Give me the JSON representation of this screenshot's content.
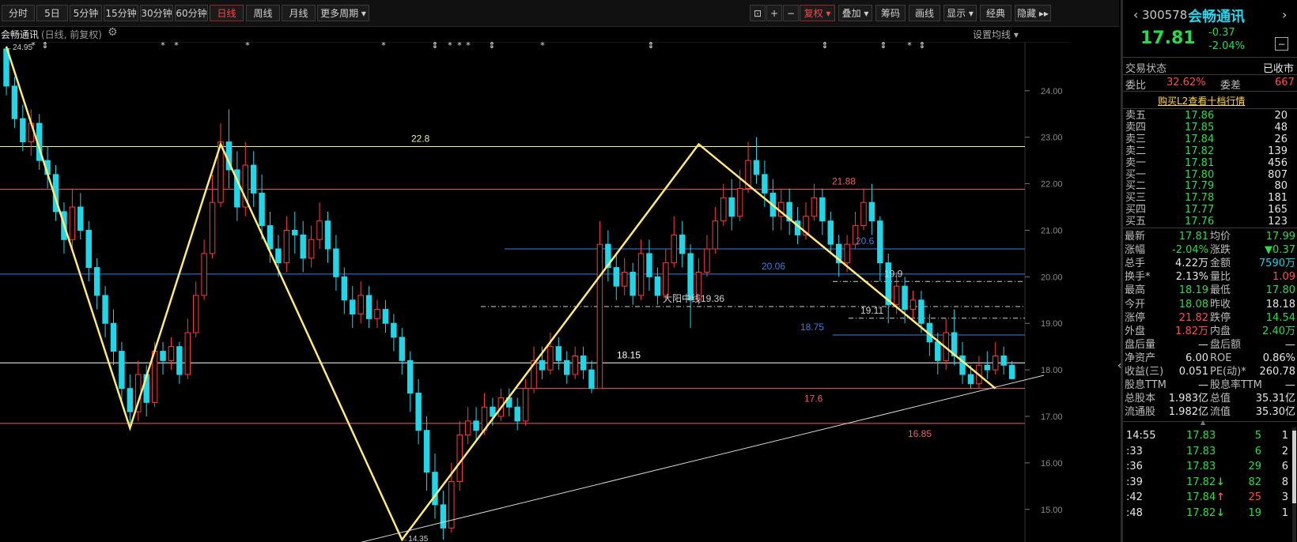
{
  "toolbar": {
    "periods": [
      "分时",
      "5日",
      "5分钟",
      "15分钟",
      "30分钟",
      "60分钟",
      "日线",
      "周线",
      "月线",
      "更多周期"
    ],
    "active_period": "日线",
    "zoom_in": "+",
    "zoom_out": "−",
    "right_buttons": [
      "复权",
      "叠加",
      "筹码",
      "画线",
      "显示",
      "经典",
      "隐藏"
    ],
    "active_right": "复权"
  },
  "chart_header": {
    "stock_name": "会畅通讯",
    "mode": "(日线, 前复权)",
    "settings_link": "设置均线"
  },
  "chart_data": {
    "type": "candlestick",
    "y_ticks": [
      15.0,
      16.0,
      17.0,
      18.0,
      19.0,
      20.0,
      21.0,
      22.0,
      23.0,
      24.0
    ],
    "ylim": [
      14.3,
      25.05
    ],
    "candles": [
      [
        24.9,
        24.1,
        24.95,
        23.9
      ],
      [
        24.1,
        23.4,
        24.3,
        23.2
      ],
      [
        23.4,
        22.9,
        23.7,
        22.7
      ],
      [
        22.9,
        23.3,
        23.6,
        22.6
      ],
      [
        23.3,
        22.5,
        23.5,
        22.3
      ],
      [
        22.5,
        22.2,
        22.8,
        21.9
      ],
      [
        22.2,
        21.4,
        22.4,
        21.2
      ],
      [
        21.4,
        20.8,
        21.6,
        20.5
      ],
      [
        20.8,
        21.5,
        21.9,
        20.6
      ],
      [
        21.5,
        21.0,
        21.8,
        20.8
      ],
      [
        21.0,
        20.2,
        21.2,
        19.9
      ],
      [
        20.2,
        19.6,
        20.4,
        19.3
      ],
      [
        19.6,
        19.0,
        19.8,
        18.7
      ],
      [
        19.0,
        18.4,
        19.3,
        18.1
      ],
      [
        18.4,
        17.6,
        18.6,
        17.3
      ],
      [
        17.6,
        17.1,
        17.9,
        16.85
      ],
      [
        17.1,
        17.9,
        18.2,
        16.9
      ],
      [
        17.9,
        17.3,
        18.1,
        17.0
      ],
      [
        17.3,
        18.4,
        18.6,
        17.2
      ],
      [
        18.4,
        18.2,
        18.6,
        17.9
      ],
      [
        18.2,
        18.5,
        18.7,
        18.0
      ],
      [
        18.5,
        17.9,
        18.6,
        17.7
      ],
      [
        17.9,
        18.8,
        19.1,
        17.8
      ],
      [
        18.8,
        19.6,
        19.9,
        18.7
      ],
      [
        19.6,
        20.5,
        20.8,
        19.5
      ],
      [
        20.5,
        21.6,
        22.2,
        20.4
      ],
      [
        21.6,
        22.9,
        23.3,
        21.5
      ],
      [
        22.9,
        22.3,
        23.6,
        21.9
      ],
      [
        22.3,
        21.5,
        22.7,
        21.2
      ],
      [
        21.5,
        22.4,
        22.9,
        21.3
      ],
      [
        22.4,
        21.8,
        22.7,
        21.5
      ],
      [
        21.8,
        21.1,
        22.2,
        20.8
      ],
      [
        21.1,
        20.6,
        21.4,
        20.3
      ],
      [
        20.6,
        20.3,
        20.9,
        20.0
      ],
      [
        20.3,
        21.0,
        21.3,
        20.1
      ],
      [
        21.0,
        20.9,
        21.4,
        20.5
      ],
      [
        20.9,
        20.4,
        21.2,
        20.1
      ],
      [
        20.4,
        20.8,
        21.1,
        20.2
      ],
      [
        20.8,
        21.2,
        21.6,
        20.6
      ],
      [
        21.2,
        20.6,
        21.4,
        20.3
      ],
      [
        20.6,
        20.0,
        20.9,
        19.7
      ],
      [
        20.0,
        19.5,
        20.2,
        19.2
      ],
      [
        19.5,
        19.2,
        19.8,
        18.9
      ],
      [
        19.2,
        19.6,
        19.9,
        19.0
      ],
      [
        19.6,
        19.1,
        19.8,
        18.9
      ],
      [
        19.1,
        19.3,
        19.5,
        18.9
      ],
      [
        19.3,
        19.0,
        19.5,
        18.8
      ],
      [
        19.0,
        18.7,
        19.2,
        18.4
      ],
      [
        18.7,
        18.2,
        18.9,
        17.9
      ],
      [
        18.2,
        17.5,
        18.4,
        17.1
      ],
      [
        17.5,
        16.7,
        17.8,
        16.4
      ],
      [
        16.7,
        15.8,
        17.0,
        15.4
      ],
      [
        15.8,
        15.1,
        16.2,
        14.8
      ],
      [
        15.1,
        14.6,
        15.4,
        14.35
      ],
      [
        14.6,
        15.6,
        16.0,
        14.5
      ],
      [
        15.6,
        16.6,
        16.9,
        15.4
      ],
      [
        16.6,
        16.9,
        17.2,
        16.4
      ],
      [
        16.9,
        16.7,
        17.2,
        16.5
      ],
      [
        16.7,
        17.2,
        17.5,
        16.6
      ],
      [
        17.2,
        17.0,
        17.4,
        16.8
      ],
      [
        17.0,
        17.4,
        17.6,
        16.9
      ],
      [
        17.4,
        17.2,
        17.6,
        17.0
      ],
      [
        17.2,
        16.9,
        17.4,
        16.7
      ],
      [
        16.9,
        17.6,
        17.8,
        16.8
      ],
      [
        17.6,
        18.2,
        18.5,
        17.5
      ],
      [
        18.2,
        18.0,
        18.5,
        17.8
      ],
      [
        18.0,
        18.5,
        18.8,
        17.9
      ],
      [
        18.5,
        18.2,
        18.7,
        18.0
      ],
      [
        18.2,
        17.9,
        18.4,
        17.7
      ],
      [
        17.9,
        18.3,
        18.5,
        17.8
      ],
      [
        18.3,
        18.0,
        18.5,
        17.8
      ],
      [
        18.0,
        17.6,
        18.2,
        17.5
      ],
      [
        17.6,
        20.7,
        21.2,
        17.6
      ],
      [
        20.7,
        20.2,
        21.0,
        19.9
      ],
      [
        20.2,
        19.8,
        20.5,
        19.5
      ],
      [
        19.8,
        20.1,
        20.4,
        19.6
      ],
      [
        20.1,
        19.6,
        20.3,
        19.4
      ],
      [
        19.6,
        20.5,
        20.8,
        19.5
      ],
      [
        20.5,
        20.0,
        20.8,
        19.7
      ],
      [
        20.0,
        19.6,
        20.2,
        19.4
      ],
      [
        19.6,
        20.3,
        20.6,
        19.5
      ],
      [
        20.3,
        20.9,
        21.3,
        20.2
      ],
      [
        20.9,
        20.5,
        21.2,
        20.2
      ],
      [
        20.5,
        19.5,
        20.7,
        18.9
      ],
      [
        19.5,
        20.1,
        20.4,
        19.4
      ],
      [
        20.1,
        20.6,
        20.9,
        20.0
      ],
      [
        20.6,
        21.2,
        21.5,
        20.5
      ],
      [
        21.2,
        21.7,
        22.0,
        21.1
      ],
      [
        21.7,
        21.3,
        22.1,
        21.0
      ],
      [
        21.3,
        21.9,
        22.3,
        21.2
      ],
      [
        21.9,
        22.5,
        22.9,
        21.8
      ],
      [
        22.5,
        22.2,
        23.0,
        22.0
      ],
      [
        22.2,
        21.8,
        22.5,
        21.5
      ],
      [
        21.8,
        21.3,
        22.1,
        21.0
      ],
      [
        21.3,
        21.6,
        21.9,
        21.0
      ],
      [
        21.6,
        21.2,
        21.9,
        20.9
      ],
      [
        21.2,
        20.9,
        21.5,
        20.7
      ],
      [
        20.9,
        21.3,
        21.6,
        20.8
      ],
      [
        21.3,
        21.7,
        22.0,
        21.2
      ],
      [
        21.7,
        21.2,
        21.9,
        20.9
      ],
      [
        21.2,
        20.7,
        21.4,
        20.5
      ],
      [
        20.7,
        20.3,
        20.9,
        20.0
      ],
      [
        20.3,
        20.7,
        20.9,
        20.1
      ],
      [
        20.7,
        21.1,
        21.4,
        20.6
      ],
      [
        21.1,
        21.6,
        21.9,
        21.0
      ],
      [
        21.6,
        21.2,
        22.0,
        20.9
      ],
      [
        21.2,
        20.3,
        21.3,
        19.9
      ],
      [
        20.3,
        19.4,
        20.5,
        19.0
      ],
      [
        19.4,
        19.8,
        20.1,
        19.2
      ],
      [
        19.8,
        19.3,
        20.0,
        19.0
      ],
      [
        19.3,
        19.5,
        19.7,
        19.1
      ],
      [
        19.5,
        19.0,
        19.7,
        18.8
      ],
      [
        19.0,
        18.6,
        19.2,
        18.3
      ],
      [
        18.6,
        18.2,
        18.8,
        17.9
      ],
      [
        18.2,
        18.8,
        19.1,
        18.0
      ],
      [
        18.8,
        18.3,
        19.3,
        18.1
      ],
      [
        18.3,
        17.9,
        18.6,
        17.7
      ],
      [
        17.9,
        17.7,
        18.1,
        17.6
      ],
      [
        17.7,
        18.1,
        18.3,
        17.6
      ],
      [
        18.1,
        18.0,
        18.4,
        17.8
      ],
      [
        18.0,
        18.3,
        18.6,
        17.9
      ],
      [
        18.3,
        18.1,
        18.5,
        17.9
      ],
      [
        18.1,
        17.81,
        18.19,
        17.8
      ]
    ],
    "levels": [
      {
        "value": 22.8,
        "label": "22.8",
        "color": "#f0f0a0"
      },
      {
        "value": 21.88,
        "label": "21.88",
        "color": "#e86060"
      },
      {
        "value": 20.6,
        "label": "20.6",
        "color": "#3a7fe0"
      },
      {
        "value": 20.06,
        "label": "20.06",
        "color": "#3a7fe0"
      },
      {
        "value": 19.9,
        "label": "19.9",
        "color": "#cfcfcf"
      },
      {
        "value": 19.36,
        "label": "大阳中线19.36",
        "color": "#cfcfcf"
      },
      {
        "value": 19.11,
        "label": "19.11",
        "color": "#cfcfcf"
      },
      {
        "value": 18.75,
        "label": "18.75",
        "color": "#3a7fe0"
      },
      {
        "value": 18.15,
        "label": "18.15",
        "color": "#ffffff"
      },
      {
        "value": 17.6,
        "label": "17.6",
        "color": "#e86060"
      },
      {
        "value": 16.85,
        "label": "16.85",
        "color": "#e86060"
      }
    ],
    "zigzag": [
      [
        0,
        24.95
      ],
      [
        15,
        16.75
      ],
      [
        26,
        22.85
      ],
      [
        48,
        14.35
      ],
      [
        84,
        22.85
      ],
      [
        120,
        17.6
      ]
    ],
    "trendline": [
      [
        42,
        14.3
      ],
      [
        123,
        17.85
      ]
    ],
    "extreme_labels": [
      {
        "index": 0,
        "value": 24.95,
        "text": "←24.95"
      },
      {
        "index": 48,
        "value": 14.35,
        "text": "←14.35"
      }
    ],
    "event_marks": [
      "*",
      "⇕",
      "*",
      "*",
      "*",
      "*",
      "⇕",
      "*",
      "*",
      "*",
      "⇕",
      "*",
      "⇕",
      "⇕",
      "⇕",
      "*",
      "⇕"
    ]
  },
  "quote": {
    "code": "300578",
    "name": "会畅通讯",
    "price": "17.81",
    "change": "-0.37",
    "change_pct": "-2.04%",
    "status_label": "交易状态",
    "status_value": "已收市",
    "weibi_label": "委比",
    "weibi_value": "32.62%",
    "weicha_label": "委差",
    "weicha_value": "667",
    "l2_link": "购买L2查看十档行情",
    "asks": [
      {
        "label": "卖五",
        "price": "17.86",
        "vol": "20"
      },
      {
        "label": "卖四",
        "price": "17.85",
        "vol": "48"
      },
      {
        "label": "卖三",
        "price": "17.84",
        "vol": "26"
      },
      {
        "label": "卖二",
        "price": "17.82",
        "vol": "139"
      },
      {
        "label": "卖一",
        "price": "17.81",
        "vol": "456"
      }
    ],
    "bids": [
      {
        "label": "买一",
        "price": "17.80",
        "vol": "807"
      },
      {
        "label": "买二",
        "price": "17.79",
        "vol": "80"
      },
      {
        "label": "买三",
        "price": "17.78",
        "vol": "181"
      },
      {
        "label": "买四",
        "price": "17.77",
        "vol": "165"
      },
      {
        "label": "买五",
        "price": "17.76",
        "vol": "123"
      }
    ],
    "stats": [
      {
        "l1": "最新",
        "v1": "17.81",
        "c1": "green",
        "l2": "均价",
        "v2": "17.99",
        "c2": "green"
      },
      {
        "l1": "涨幅",
        "v1": "-2.04%",
        "c1": "green",
        "l2": "涨跌",
        "v2": "▼0.37",
        "c2": "green"
      },
      {
        "l1": "总手",
        "v1": "4.22万",
        "c1": "white",
        "l2": "金额",
        "v2": "7590万",
        "c2": "cyan"
      },
      {
        "l1": "换手*",
        "v1": "2.13%",
        "c1": "white",
        "l2": "量比",
        "v2": "1.09",
        "c2": "red"
      },
      {
        "l1": "最高",
        "v1": "18.19",
        "c1": "green",
        "l2": "最低",
        "v2": "17.80",
        "c2": "green"
      },
      {
        "l1": "今开",
        "v1": "18.08",
        "c1": "green",
        "l2": "昨收",
        "v2": "18.18",
        "c2": "white"
      },
      {
        "l1": "涨停",
        "v1": "21.82",
        "c1": "red",
        "l2": "跌停",
        "v2": "14.54",
        "c2": "green"
      },
      {
        "l1": "外盘",
        "v1": "1.82万",
        "c1": "red",
        "l2": "内盘",
        "v2": "2.40万",
        "c2": "green"
      },
      {
        "l1": "盘后量",
        "v1": "—",
        "c1": "white",
        "l2": "盘后额",
        "v2": "—",
        "c2": "white"
      },
      {
        "l1": "净资产",
        "v1": "6.00",
        "c1": "white",
        "l2": "ROE",
        "v2": "0.86%",
        "c2": "white"
      },
      {
        "l1": "收益(三)",
        "v1": "0.051",
        "c1": "white",
        "l2": "PE(动)*",
        "v2": "260.78",
        "c2": "white"
      },
      {
        "l1": "股息TTM",
        "v1": "—",
        "c1": "white",
        "l2": "股息率TTM",
        "v2": "—",
        "c2": "white"
      },
      {
        "l1": "总股本",
        "v1": "1.983亿",
        "c1": "white",
        "l2": "总值",
        "v2": "35.31亿",
        "c2": "white"
      },
      {
        "l1": "流通股",
        "v1": "1.982亿",
        "c1": "white",
        "l2": "流值",
        "v2": "35.30亿",
        "c2": "white"
      }
    ],
    "ticks": [
      {
        "time": "14:55",
        "price": "17.83",
        "arrow": "",
        "vol": "5",
        "vol_color": "green",
        "n": "1"
      },
      {
        "time": ":33",
        "price": "17.83",
        "arrow": "",
        "vol": "6",
        "vol_color": "green",
        "n": "2"
      },
      {
        "time": ":36",
        "price": "17.83",
        "arrow": "",
        "vol": "29",
        "vol_color": "green",
        "n": "6"
      },
      {
        "time": ":39",
        "price": "17.82",
        "arrow": "↓",
        "vol": "82",
        "vol_color": "green",
        "n": "8"
      },
      {
        "time": ":42",
        "price": "17.84",
        "arrow": "↑",
        "vol": "25",
        "vol_color": "red",
        "n": "3"
      },
      {
        "time": ":48",
        "price": "17.82",
        "arrow": "↓",
        "vol": "19",
        "vol_color": "green",
        "n": "1"
      }
    ]
  }
}
